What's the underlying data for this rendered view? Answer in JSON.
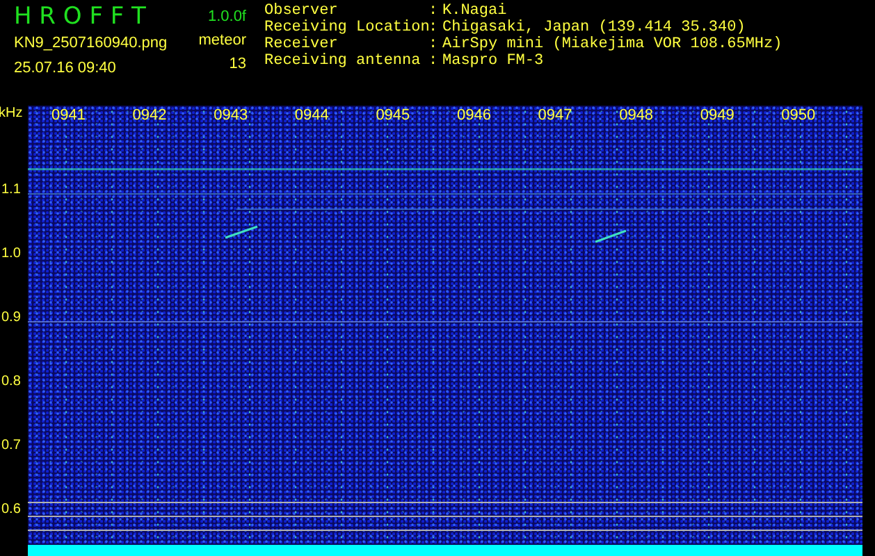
{
  "app": {
    "title": "H R O F F T",
    "version": "1.0.0f",
    "file_name": "KN9_2507160940.png",
    "timestamp": "25.07.16 09:40",
    "meteor_label": "meteor",
    "meteor_count": "13"
  },
  "station_info": [
    {
      "label": "Observer",
      "separator": ":",
      "value": "K.Nagai"
    },
    {
      "label": "Receiving Location",
      "separator": ":",
      "value": "Chigasaki, Japan (139.414 35.340)"
    },
    {
      "label": "Receiver",
      "separator": ":",
      "value": "AirSpy mini (Miakejima VOR 108.65MHz)"
    },
    {
      "label": "Receiving antenna",
      "separator": ":",
      "value": "Maspro FM-3"
    }
  ],
  "spectrogram": {
    "y_unit": "kHz",
    "y_labels": [
      "1.1",
      "1.0",
      "0.9",
      "0.8",
      "0.7",
      "0.6"
    ],
    "time_labels": [
      "0941",
      "0942",
      "0943",
      "0944",
      "0945",
      "0946",
      "0947",
      "0948",
      "0949",
      "0950"
    ]
  }
}
